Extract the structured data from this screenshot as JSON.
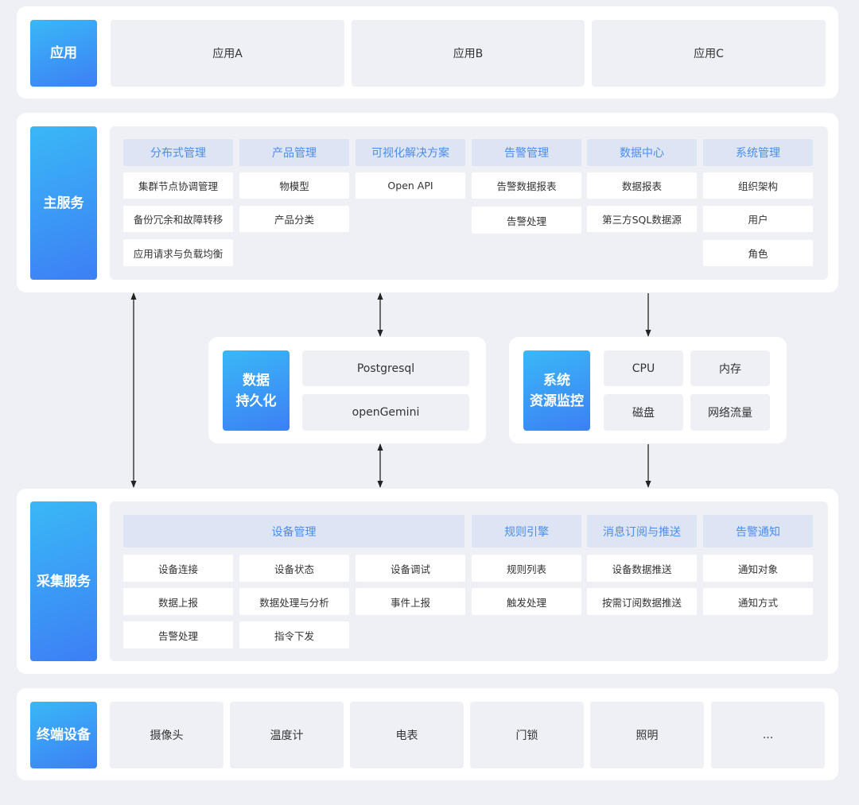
{
  "app_layer": {
    "label": "应用",
    "apps": [
      "应用A",
      "应用B",
      "应用C"
    ]
  },
  "main_service": {
    "label": "主服务",
    "columns": [
      {
        "header": "分布式管理",
        "items": [
          "集群节点协调管理",
          "备份冗余和故障转移",
          "应用请求与负载均衡"
        ]
      },
      {
        "header": "产品管理",
        "items": [
          "物模型",
          "产品分类"
        ]
      },
      {
        "header": "可视化解决方案",
        "items": [
          "Open API"
        ]
      },
      {
        "header": "告警管理",
        "items": [
          "告警数据报表",
          "告警处理"
        ]
      },
      {
        "header": "数据中心",
        "items": [
          "数据报表",
          "第三方SQL数据源"
        ]
      },
      {
        "header": "系统管理",
        "items": [
          "组织架构",
          "用户",
          "角色"
        ]
      }
    ]
  },
  "persistence": {
    "label": "数据\n持久化",
    "items": [
      "Postgresql",
      "openGemini"
    ]
  },
  "monitor": {
    "label": "系统\n资源监控",
    "items": [
      "CPU",
      "内存",
      "磁盘",
      "网络流量"
    ]
  },
  "collect_service": {
    "label": "采集服务",
    "device_mgmt": {
      "header": "设备管理",
      "items": [
        "设备连接",
        "设备状态",
        "设备调试",
        "数据上报",
        "数据处理与分析",
        "事件上报",
        "告警处理",
        "指令下发"
      ]
    },
    "columns": [
      {
        "header": "规则引擎",
        "items": [
          "规则列表",
          "触发处理"
        ]
      },
      {
        "header": "消息订阅与推送",
        "items": [
          "设备数据推送",
          "按需订阅数据推送"
        ]
      },
      {
        "header": "告警通知",
        "items": [
          "通知对象",
          "通知方式"
        ]
      }
    ]
  },
  "devices": {
    "label": "终端设备",
    "items": [
      "摄像头",
      "温度计",
      "电表",
      "门锁",
      "照明",
      "..."
    ]
  },
  "colors": {
    "accent_gradient_start": "#3ab8f6",
    "accent_gradient_end": "#3c7ff5",
    "header_bg": "#dde5f4",
    "header_text": "#4a8cf0",
    "page_bg": "#eef0f5"
  }
}
